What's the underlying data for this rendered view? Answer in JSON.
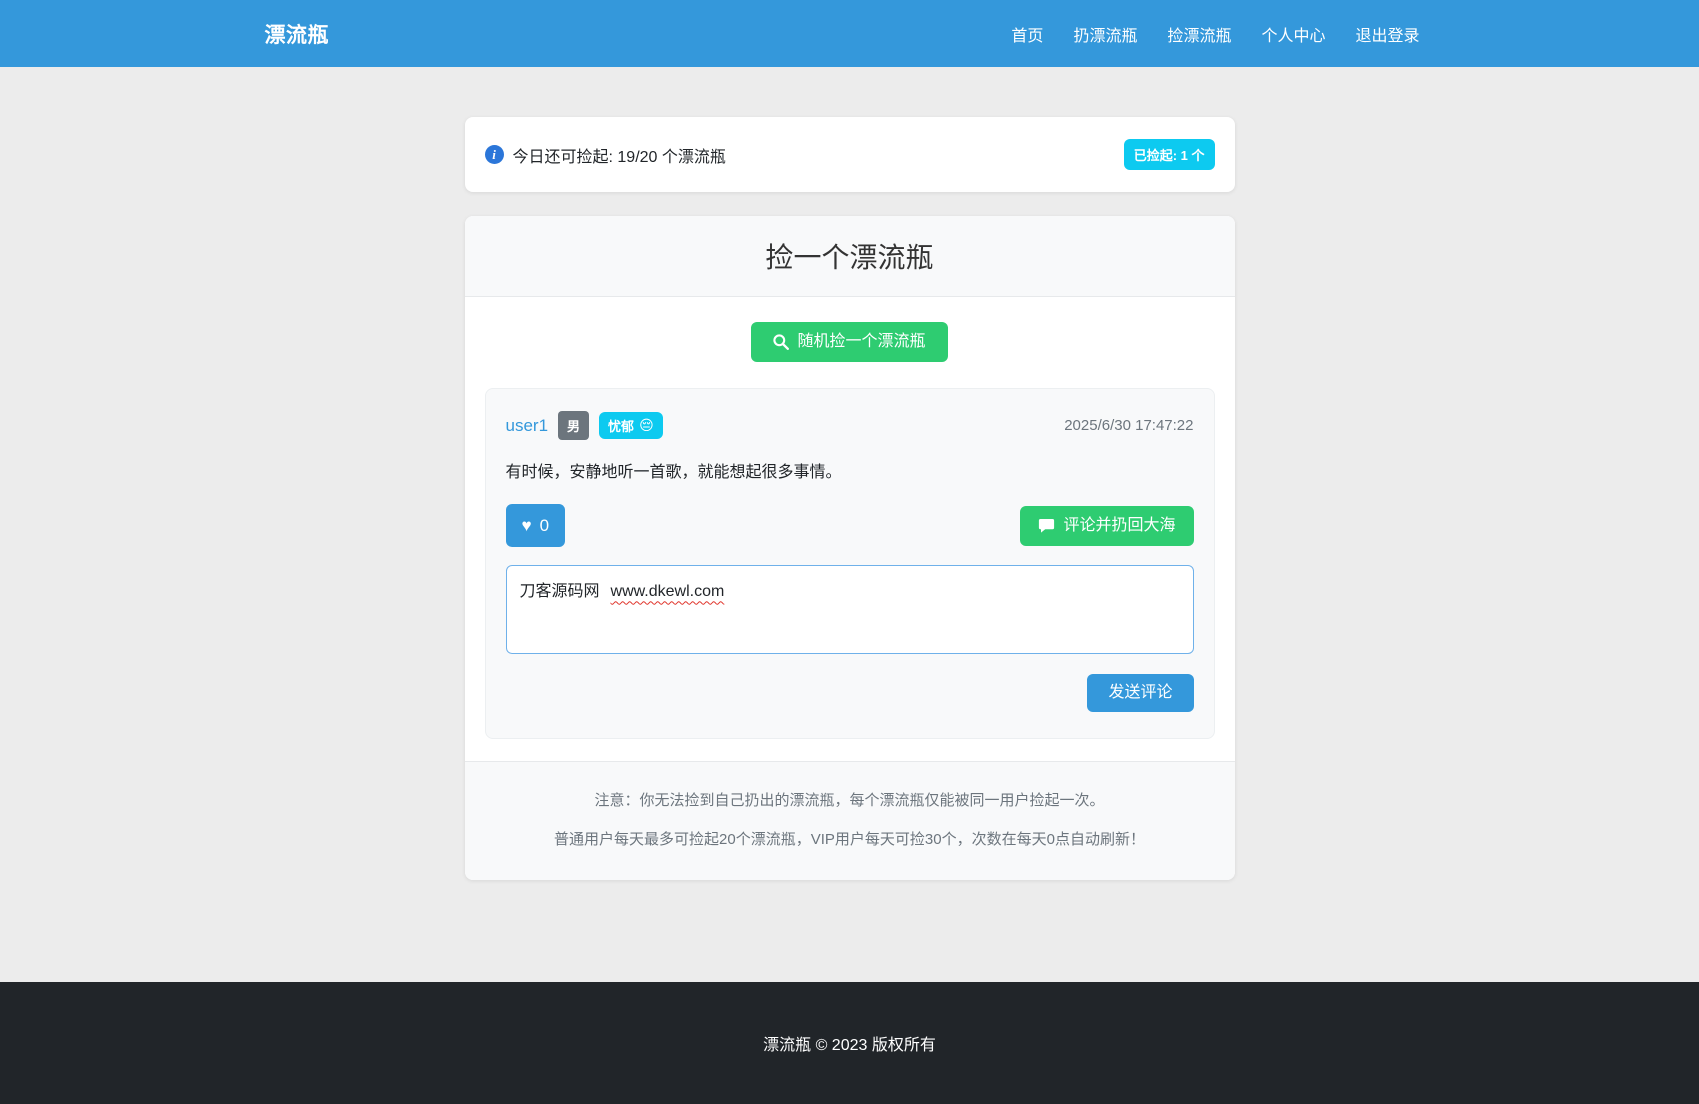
{
  "colors": {
    "navbar": "#3498db",
    "primary": "#3498db",
    "success": "#2ecc71",
    "info_badge": "#0dcaf0",
    "secondary_badge": "#6c757d",
    "footer_bg": "#212529",
    "page_bg": "#ececec",
    "info_icon": "#2b76d9"
  },
  "navbar": {
    "brand": "漂流瓶",
    "items": [
      {
        "label": "首页"
      },
      {
        "label": "扔漂流瓶"
      },
      {
        "label": "捡漂流瓶"
      },
      {
        "label": "个人中心"
      },
      {
        "label": "退出登录"
      }
    ]
  },
  "quota": {
    "icon": "info-icon",
    "text": "今日还可捡起: 19/20 个漂流瓶",
    "badge": "已捡起: 1 个"
  },
  "pick": {
    "title": "捡一个漂流瓶",
    "random_button_icon": "search-icon",
    "random_button": "随机捡一个漂流瓶"
  },
  "bottle": {
    "username": "user1",
    "gender": "男",
    "mood": "忧郁",
    "mood_emoji": "😔",
    "time": "2025/6/30 17:47:22",
    "message": "有时候，安静地听一首歌，就能想起很多事情。",
    "like_icon": "heart-icon",
    "likes": "0",
    "comment_button_icon": "speech-bubble-icon",
    "comment_button": "评论并扔回大海",
    "comment_input": {
      "prefix": "刀客源码网",
      "url": "www.dkewl.com"
    },
    "send_button": "发送评论"
  },
  "notes": {
    "line1": "注意：你无法捡到自己扔出的漂流瓶，每个漂流瓶仅能被同一用户捡起一次。",
    "line2": "普通用户每天最多可捡起20个漂流瓶，VIP用户每天可捡30个，次数在每天0点自动刷新！"
  },
  "footer": {
    "text": "漂流瓶 © 2023 版权所有"
  }
}
